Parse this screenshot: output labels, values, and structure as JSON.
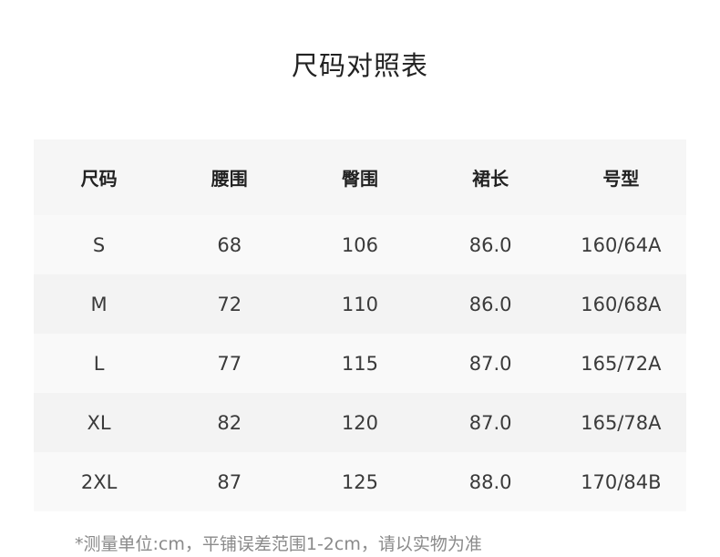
{
  "title": "尺码对照表",
  "table": {
    "headers": [
      "尺码",
      "腰围",
      "臀围",
      "裙长",
      "号型"
    ],
    "rows": [
      [
        "S",
        "68",
        "106",
        "86.0",
        "160/64A"
      ],
      [
        "M",
        "72",
        "110",
        "86.0",
        "160/68A"
      ],
      [
        "L",
        "77",
        "115",
        "87.0",
        "165/72A"
      ],
      [
        "XL",
        "82",
        "120",
        "87.0",
        "165/78A"
      ],
      [
        "2XL",
        "87",
        "125",
        "88.0",
        "170/84B"
      ]
    ]
  },
  "note": "*测量单位:cm，平铺误差范围1-2cm，请以实物为准",
  "colors": {
    "header_bg": "#f6f6f6",
    "row_bg_light": "#f9f9f9",
    "row_bg_dark": "#f3f3f3",
    "note_text": "#8a8a8a"
  }
}
